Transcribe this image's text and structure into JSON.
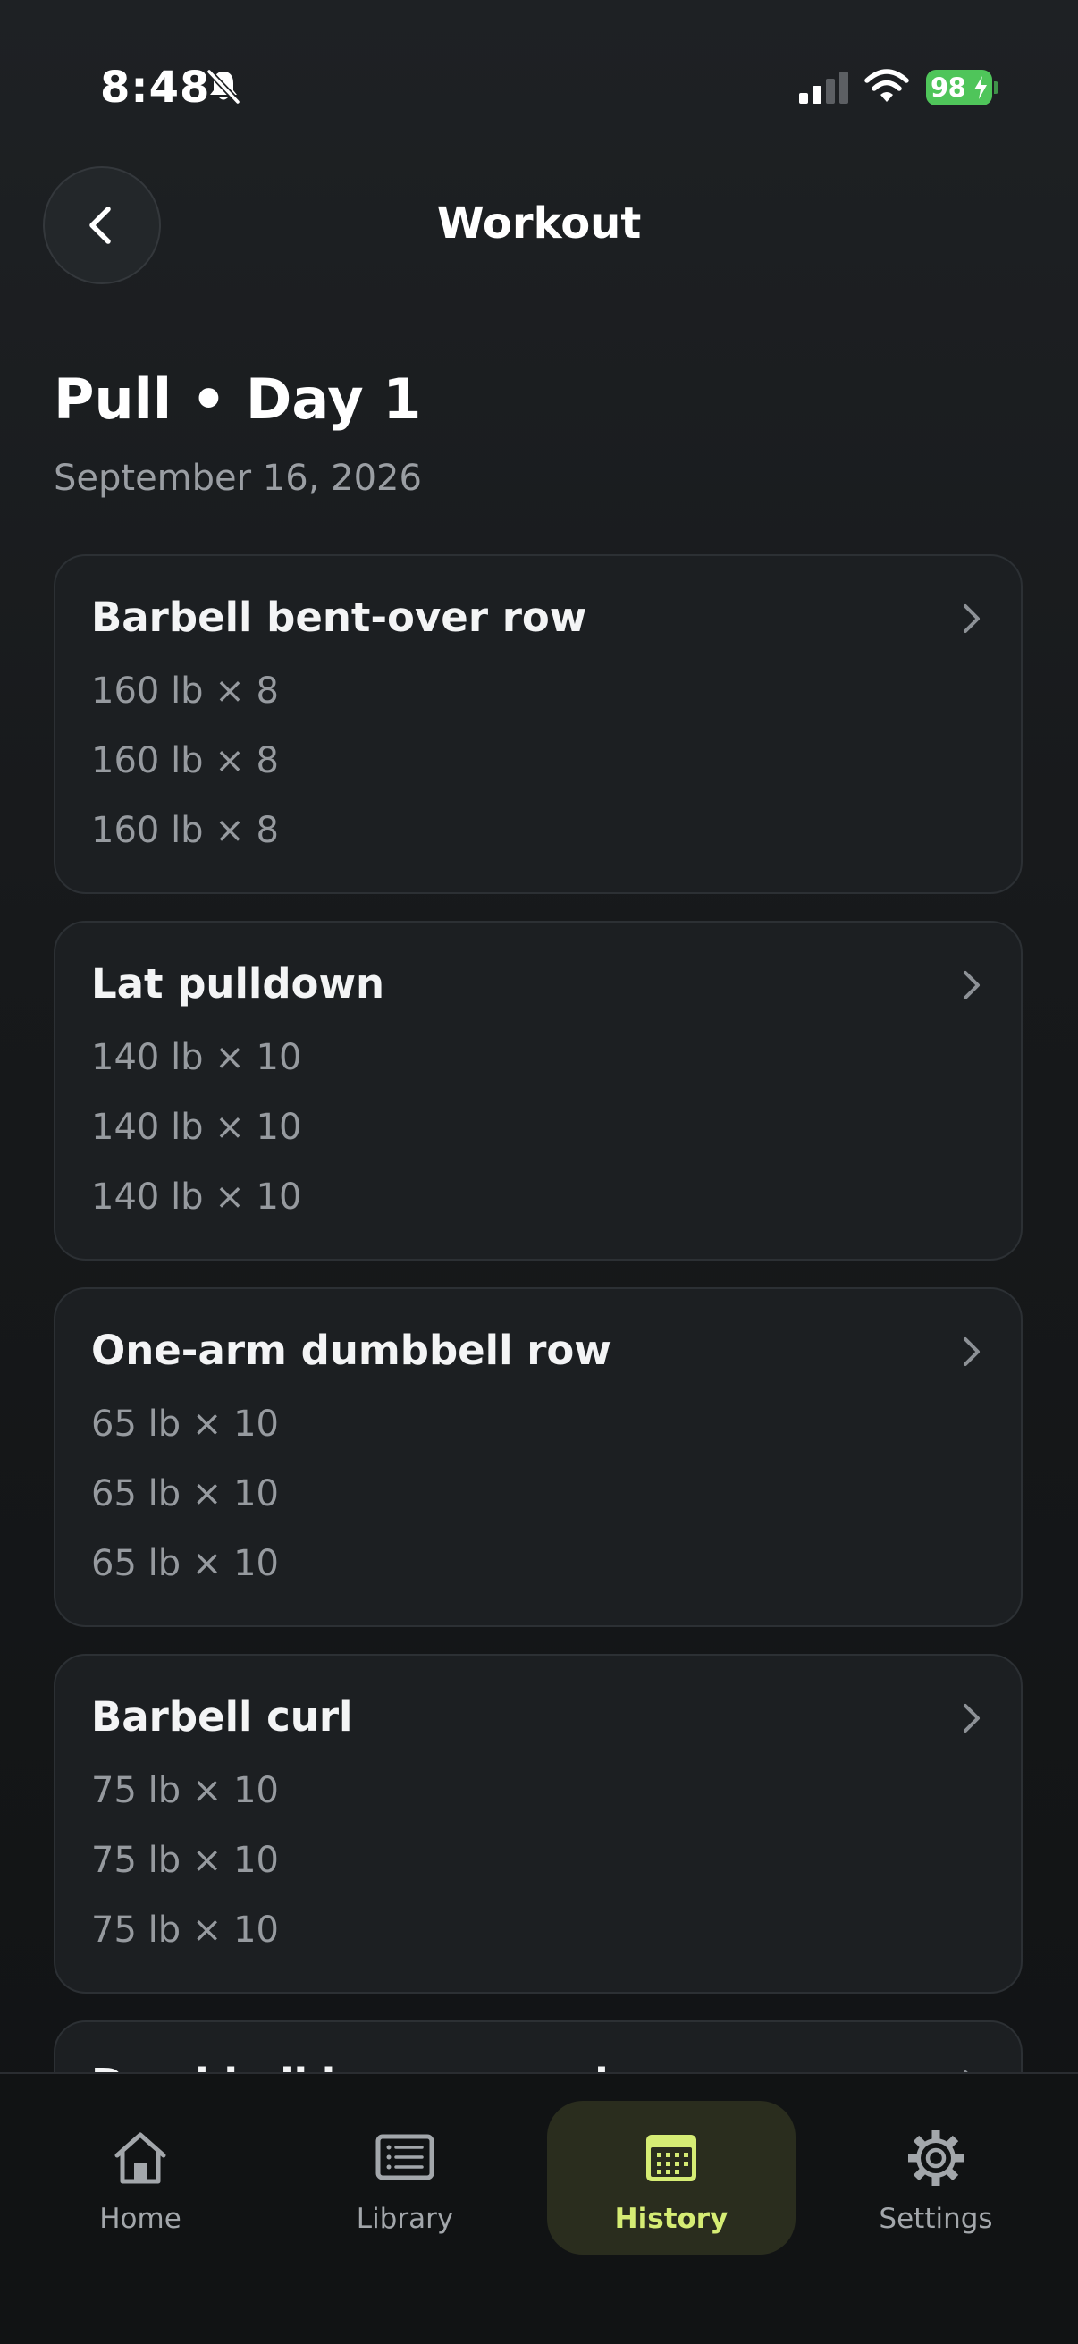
{
  "status_bar": {
    "time": "8:48",
    "battery": "98"
  },
  "header": {
    "title": "Workout"
  },
  "workout": {
    "title": "Pull • Day 1",
    "date": "September 16, 2026"
  },
  "exercises": [
    {
      "name": "Barbell bent-over row",
      "sets": [
        "160 lb × 8",
        "160 lb × 8",
        "160 lb × 8"
      ]
    },
    {
      "name": "Lat pulldown",
      "sets": [
        "140 lb × 10",
        "140 lb × 10",
        "140 lb × 10"
      ]
    },
    {
      "name": "One-arm dumbbell row",
      "sets": [
        "65 lb × 10",
        "65 lb × 10",
        "65 lb × 10"
      ]
    },
    {
      "name": "Barbell curl",
      "sets": [
        "75 lb × 10",
        "75 lb × 10",
        "75 lb × 10"
      ]
    },
    {
      "name": "Dumbbell hammer curl",
      "sets": []
    }
  ],
  "tabs": [
    {
      "label": "Home",
      "icon": "home-icon",
      "active": false
    },
    {
      "label": "Library",
      "icon": "library-icon",
      "active": false
    },
    {
      "label": "History",
      "icon": "calendar-icon",
      "active": true
    },
    {
      "label": "Settings",
      "icon": "gear-icon",
      "active": false
    }
  ],
  "colors": {
    "accent": "#d5ec74",
    "battery": "#4fc55a",
    "background": "#17191b",
    "card": "#1c1f22"
  }
}
